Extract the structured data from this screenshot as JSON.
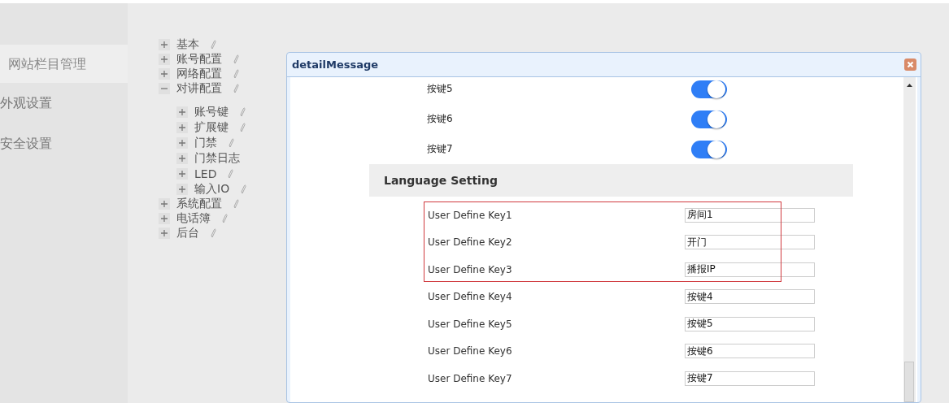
{
  "sidebar": {
    "items": [
      {
        "label": "网站栏目管理",
        "selected": true
      },
      {
        "label": "外观设置",
        "selected": false
      },
      {
        "label": "安全设置",
        "selected": false
      }
    ]
  },
  "tree": [
    {
      "label": "基本",
      "expanded": false,
      "pencil": true
    },
    {
      "label": "账号配置",
      "expanded": false,
      "pencil": true
    },
    {
      "label": "网络配置",
      "expanded": false,
      "pencil": true
    },
    {
      "label": "对讲配置",
      "expanded": true,
      "pencil": true,
      "children": [
        {
          "label": "账号键",
          "expanded": false,
          "pencil": true
        },
        {
          "label": "扩展键",
          "expanded": false,
          "pencil": true
        },
        {
          "label": "门禁",
          "expanded": false,
          "pencil": true
        },
        {
          "label": "门禁日志",
          "expanded": false,
          "pencil": false
        },
        {
          "label": "LED",
          "expanded": false,
          "pencil": true
        },
        {
          "label": "输入IO",
          "expanded": false,
          "pencil": true
        }
      ]
    },
    {
      "label": "系统配置",
      "expanded": false,
      "pencil": true
    },
    {
      "label": "电话簿",
      "expanded": false,
      "pencil": true
    },
    {
      "label": "后台",
      "expanded": false,
      "pencil": true
    }
  ],
  "dialog": {
    "title": "detailMessage",
    "toggles": [
      {
        "label": "按键5",
        "on": true
      },
      {
        "label": "按键6",
        "on": true
      },
      {
        "label": "按键7",
        "on": true
      }
    ],
    "language_setting": {
      "title": "Language Setting",
      "rows": [
        {
          "label": "User Define Key1",
          "value": "房间1",
          "highlighted": true
        },
        {
          "label": "User Define Key2",
          "value": "开门",
          "highlighted": true
        },
        {
          "label": "User Define Key3",
          "value": "播报IP",
          "highlighted": true
        },
        {
          "label": "User Define Key4",
          "value": "按键4",
          "highlighted": false
        },
        {
          "label": "User Define Key5",
          "value": "按键5",
          "highlighted": false
        },
        {
          "label": "User Define Key6",
          "value": "按键6",
          "highlighted": false
        },
        {
          "label": "User Define Key7",
          "value": "按键7",
          "highlighted": false
        }
      ]
    }
  }
}
